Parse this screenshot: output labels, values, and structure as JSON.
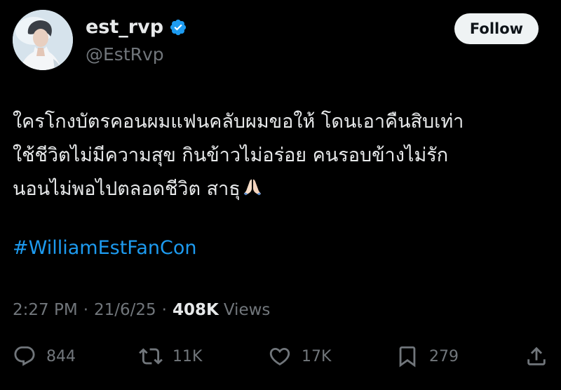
{
  "author": {
    "display_name": "est_rvp",
    "handle": "@EstRvp",
    "verified": true,
    "avatar_icon": "profile-photo"
  },
  "follow_label": "Follow",
  "tweet": {
    "lines": [
      "ใครโกงบัตรคอนผมแฟนคลับผมขอให้ โดนเอาคืนสิบเท่า",
      "ใช้ชีวิตไม่มีความสุข กินข้าวไม่อร่อย คนรอบข้างไม่รัก",
      "นอนไม่พอไปตลอดชีวิต สาธุ"
    ],
    "emoji": "folded-hands-icon",
    "hashtag": "#WilliamEstFanCon"
  },
  "meta": {
    "time": "2:27 PM",
    "date": "21/6/25",
    "separator": "·",
    "views_count": "408K",
    "views_label": "Views"
  },
  "actions": {
    "replies": "844",
    "retweets": "11K",
    "likes": "17K",
    "bookmarks": "279"
  },
  "colors": {
    "background": "#000000",
    "text": "#e7e9ea",
    "secondary": "#71767b",
    "link": "#1d9bf0",
    "follow_bg": "#eff3f4"
  }
}
